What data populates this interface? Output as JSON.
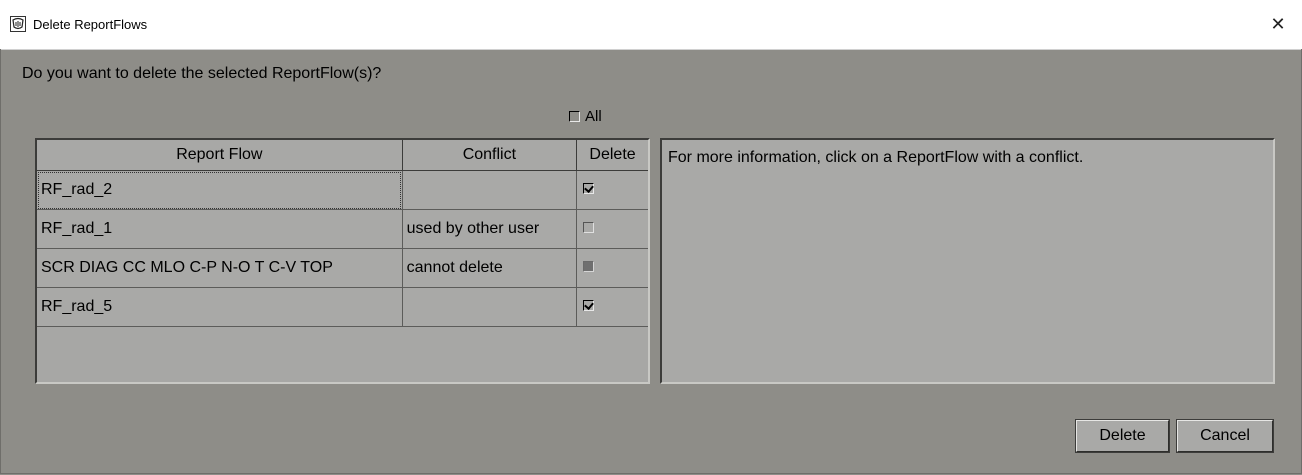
{
  "window": {
    "title": "Delete ReportFlows",
    "close_glyph": "✕"
  },
  "dialog": {
    "question": "Do you want to delete the selected ReportFlow(s)?",
    "all_label": "All",
    "all_checked": false,
    "info_text": "For more information, click on a ReportFlow with a conflict."
  },
  "table": {
    "headers": [
      "Report Flow",
      "Conflict",
      "Delete"
    ],
    "rows": [
      {
        "name": "RF_rad_2",
        "conflict": "",
        "delete": "checked"
      },
      {
        "name": "RF_rad_1",
        "conflict": "used by other user",
        "delete": "unchecked"
      },
      {
        "name": "SCR DIAG CC MLO C-P N-O T C-V TOP",
        "conflict": "cannot delete",
        "delete": "disabled"
      },
      {
        "name": "RF_rad_5",
        "conflict": "",
        "delete": "checked"
      }
    ]
  },
  "buttons": {
    "delete": "Delete",
    "cancel": "Cancel"
  }
}
